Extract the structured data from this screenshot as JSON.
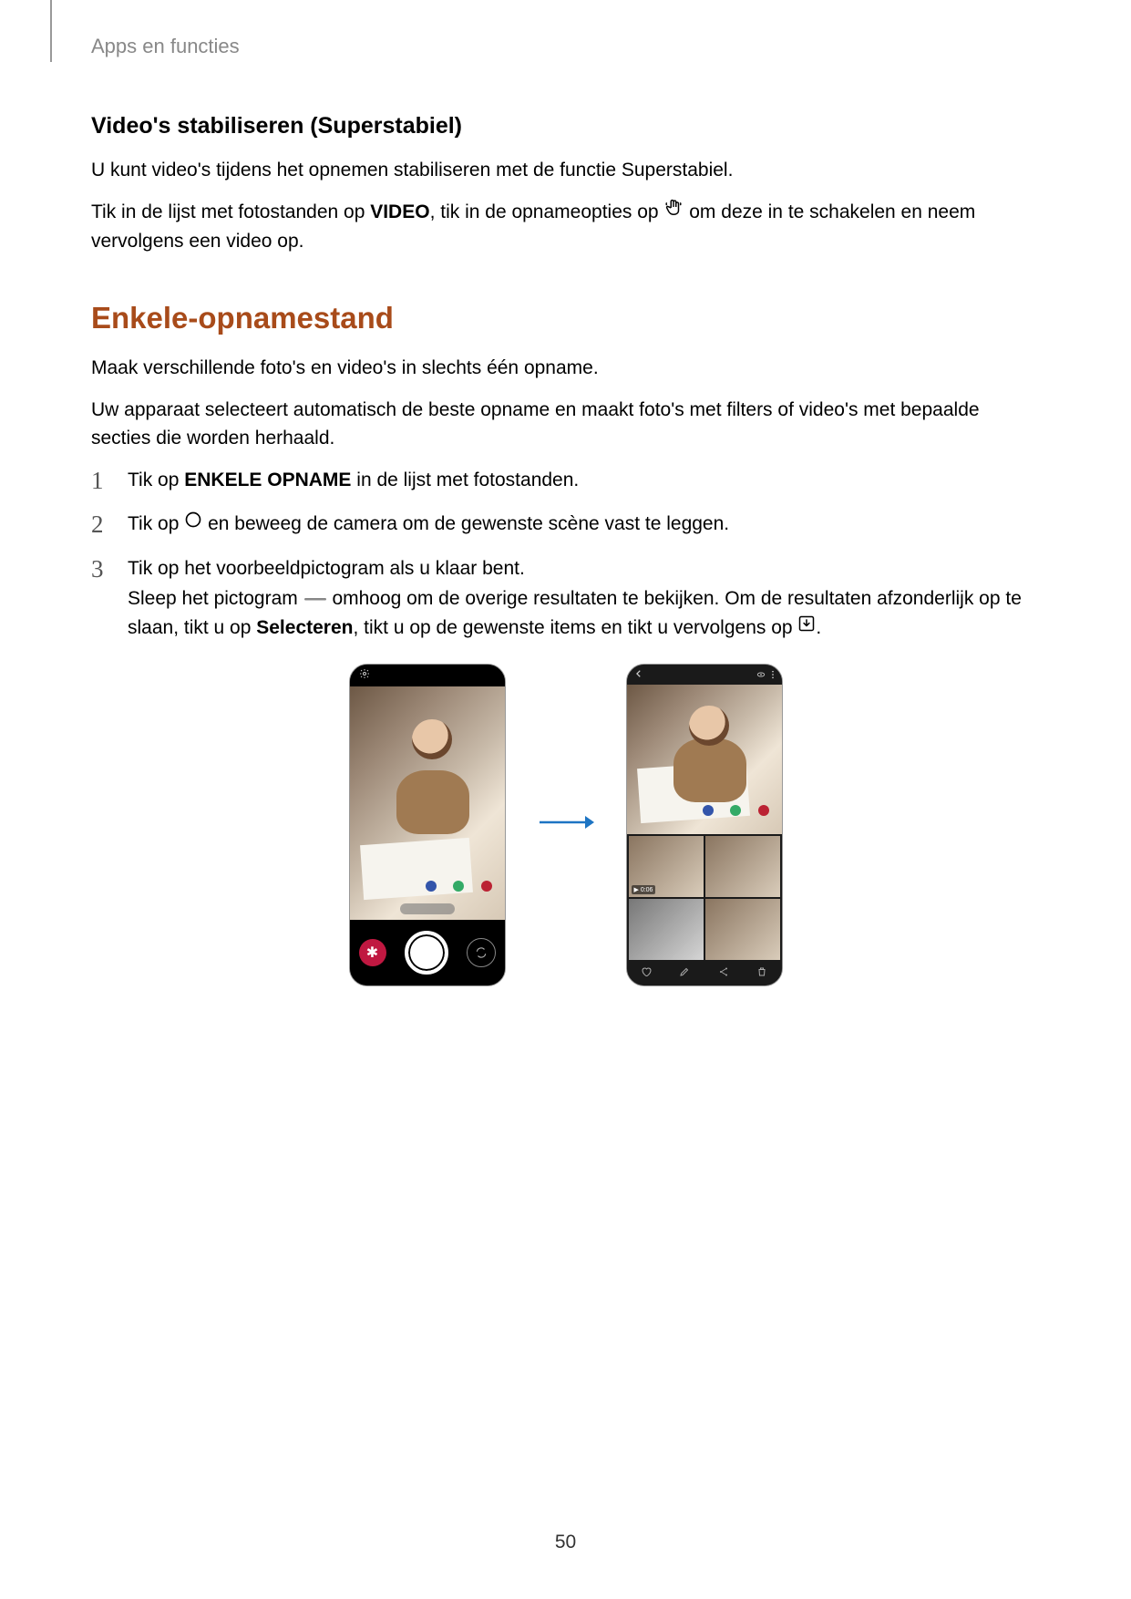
{
  "header": "Apps en functies",
  "section1": {
    "title": "Video's stabiliseren (Superstabiel)",
    "p1": "U kunt video's tijdens het opnemen stabiliseren met de functie Superstabiel.",
    "p2a": "Tik in de lijst met fotostanden op ",
    "p2_b1": "VIDEO",
    "p2b": ", tik in de opnameopties op ",
    "p2c": " om deze in te schakelen en neem vervolgens een video op."
  },
  "section2": {
    "title": "Enkele-opnamestand",
    "p1": "Maak verschillende foto's en video's in slechts één opname.",
    "p2": "Uw apparaat selecteert automatisch de beste opname en maakt foto's met filters of video's met bepaalde secties die worden herhaald.",
    "steps": {
      "s1a": "Tik op ",
      "s1b": "ENKELE OPNAME",
      "s1c": " in de lijst met fotostanden.",
      "s2a": "Tik op ",
      "s2b": " en beweeg de camera om de gewenste scène vast te leggen.",
      "s3a": "Tik op het voorbeeldpictogram als u klaar bent.",
      "s3b_a": "Sleep het pictogram ",
      "s3b_b": " omhoog om de overige resultaten te bekijken. Om de resultaten afzonderlijk op te slaan, tikt u op ",
      "s3b_bold": "Selecteren",
      "s3b_c": ", tikt u op de gewenste items en tikt u vervolgens op ",
      "s3b_d": "."
    }
  },
  "figure": {
    "video_badge": "▶ 0:06"
  },
  "pageNumber": "50"
}
